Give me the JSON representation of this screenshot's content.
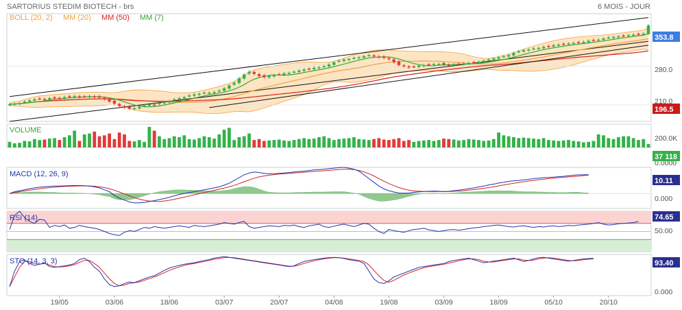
{
  "header": {
    "title": "SARTORIUS STEDIM BIOTECH - brs",
    "period": "6 MOIS - JOUR"
  },
  "colors": {
    "up": "#33b249",
    "down": "#e23a3a",
    "boll": "#f3a13c",
    "bollFill": "#fde5c3",
    "ma20": "#f3a13c",
    "ma50": "#d42020",
    "ma7": "#33aa33",
    "macd": "#2233aa",
    "signal": "#cc2222",
    "rsi": "#2233aa",
    "stoK": "#2233aa",
    "stoD": "#dd2222",
    "tagBlue": "#3d7de0",
    "tagRed": "#c81a1a",
    "tagGreen": "#33b249"
  },
  "chart_data": [
    {
      "type": "candlestick",
      "pane": "price",
      "legend": [
        {
          "label": "BOLL (20, 2)",
          "color": "#f3a13c"
        },
        {
          "label": "MM (20)",
          "color": "#f3a13c"
        },
        {
          "label": "MM (50)",
          "color": "#d42020"
        },
        {
          "label": "MM (7)",
          "color": "#33aa33"
        }
      ],
      "yticks": [
        210,
        280
      ],
      "ytick_labels": [
        "210.0",
        "280.0"
      ],
      "last_price": 353.8,
      "last_price_label": "353.8",
      "marker_value": 196.5,
      "marker_label": "196.5",
      "ylim": [
        180,
        375
      ],
      "trend_channel": {
        "upper": [
          [
            0,
            225
          ],
          [
            128,
            368
          ]
        ],
        "lower": [
          [
            0,
            180
          ],
          [
            128,
            325
          ]
        ]
      },
      "close": [
        211,
        212,
        213,
        216,
        218,
        220,
        221,
        220,
        222,
        223,
        222,
        224,
        225,
        226,
        224,
        225,
        226,
        224,
        223,
        220,
        216,
        212,
        208,
        205,
        203,
        204,
        206,
        209,
        211,
        210,
        213,
        215,
        217,
        220,
        222,
        224,
        227,
        229,
        230,
        232,
        232,
        233,
        236,
        240,
        245,
        250,
        258,
        265,
        270,
        266,
        262,
        260,
        262,
        264,
        265,
        267,
        268,
        270,
        272,
        274,
        275,
        277,
        278,
        280,
        283,
        287,
        290,
        292,
        293,
        295,
        296,
        298,
        300,
        298,
        296,
        295,
        293,
        287,
        282,
        280,
        278,
        279,
        281,
        282,
        283,
        284,
        284,
        283,
        282,
        283,
        284,
        285,
        286,
        287,
        288,
        290,
        292,
        294,
        296,
        298,
        300,
        304,
        307,
        309,
        310,
        312,
        313,
        315,
        316,
        318,
        319,
        320,
        321,
        322,
        323,
        324,
        326,
        327,
        328,
        330,
        332,
        333,
        334,
        335,
        336,
        337,
        338,
        339,
        353.8
      ],
      "volume_k": [
        60,
        45,
        50,
        70,
        65,
        90,
        80,
        85,
        95,
        100,
        80,
        110,
        130,
        180,
        70,
        140,
        150,
        170,
        120,
        130,
        150,
        90,
        160,
        140,
        70,
        65,
        80,
        60,
        220,
        180,
        120,
        90,
        100,
        120,
        110,
        130,
        90,
        85,
        100,
        120,
        110,
        95,
        140,
        190,
        210,
        80,
        110,
        120,
        150,
        80,
        90,
        70,
        75,
        80,
        85,
        75,
        70,
        80,
        90,
        100,
        90,
        95,
        110,
        120,
        100,
        80,
        90,
        95,
        100,
        110,
        90,
        85,
        80,
        90,
        100,
        85,
        80,
        90,
        100,
        70,
        80,
        60,
        70,
        75,
        80,
        70,
        80,
        95,
        90,
        85,
        75,
        80,
        90,
        85,
        80,
        70,
        75,
        90,
        160,
        130,
        120,
        110,
        100,
        105,
        100,
        95,
        90,
        100,
        80,
        75,
        70,
        75,
        80,
        70,
        65,
        55,
        60,
        70,
        140,
        130,
        100,
        90,
        110,
        120,
        120,
        100,
        80,
        90,
        37.118
      ]
    },
    {
      "type": "bar",
      "pane": "volume",
      "title": "VOLUME",
      "yticks": [
        200,
        0
      ],
      "ytick_labels": [
        "200.0K",
        "0.0000"
      ],
      "last_label": "37 118",
      "ylim": [
        0,
        250
      ]
    },
    {
      "type": "line",
      "pane": "macd",
      "title": "MACD (12, 26, 9)",
      "ytick_labels": [
        "0.000"
      ],
      "last_label": "10.11",
      "ylim": [
        -8,
        14
      ],
      "series": [
        {
          "name": "MACD",
          "values": [
            0,
            1,
            1.5,
            2,
            2.6,
            3,
            3.4,
            3.6,
            3.8,
            4,
            4,
            4.1,
            4.2,
            4.3,
            4.3,
            4.2,
            4,
            3.6,
            3,
            2,
            1,
            -1,
            -2.5,
            -3.5,
            -4.5,
            -5,
            -5,
            -4.8,
            -4.3,
            -3.8,
            -3.2,
            -2.7,
            -2,
            -1.2,
            -0.5,
            0,
            0.5,
            1,
            1.5,
            2,
            2.5,
            3,
            3.6,
            4.5,
            5.5,
            7,
            8.5,
            10,
            11,
            11.5,
            11.2,
            10.8,
            10.5,
            10.6,
            10.8,
            11,
            11.2,
            11.5,
            11.8,
            12,
            12.3,
            12.6,
            12.8,
            13,
            13.3,
            13.6,
            13.8,
            14,
            13.6,
            13,
            12,
            10,
            8,
            6,
            4,
            2.5,
            1.5,
            0.8,
            0.3,
            0.2,
            0.3,
            0.6,
            0.9,
            1.1,
            1.2,
            1.3,
            1.2,
            1,
            1.2,
            1.5,
            1.8,
            2.2,
            2.6,
            3,
            3.5,
            4,
            4.6,
            5,
            5.6,
            6,
            6.5,
            6.8,
            7,
            7.3,
            7.6,
            8,
            8.2,
            8.5,
            8.6,
            8.8,
            9,
            9.2,
            9.5,
            9.8,
            10,
            10,
            10.11
          ]
        },
        {
          "name": "Signal",
          "values": [
            0,
            0.5,
            1,
            1.4,
            1.8,
            2.2,
            2.6,
            2.9,
            3.2,
            3.4,
            3.6,
            3.8,
            3.9,
            4,
            4.1,
            4.1,
            4,
            3.9,
            3.6,
            3.2,
            2.6,
            1.8,
            0.8,
            -0.2,
            -1.2,
            -2.2,
            -3,
            -3.6,
            -4,
            -4.2,
            -4.2,
            -4,
            -3.6,
            -3.1,
            -2.5,
            -1.9,
            -1.3,
            -0.7,
            -0.1,
            0.5,
            1.1,
            1.7,
            2.3,
            2.9,
            3.6,
            4.4,
            5.3,
            6.3,
            7.3,
            8.2,
            8.9,
            9.4,
            9.8,
            10.1,
            10.4,
            10.6,
            10.8,
            11,
            11.2,
            11.4,
            11.6,
            11.8,
            12,
            12.2,
            12.4,
            12.6,
            12.8,
            13,
            13,
            12.8,
            12.3,
            11.6,
            10.6,
            9.4,
            8,
            6.6,
            5.3,
            4.2,
            3.2,
            2.4,
            1.8,
            1.4,
            1.2,
            1.1,
            1.1,
            1.1,
            1.1,
            1.1,
            1.1,
            1.2,
            1.3,
            1.5,
            1.8,
            2.1,
            2.4,
            2.8,
            3.2,
            3.6,
            4.1,
            4.6,
            5,
            5.5,
            5.9,
            6.3,
            6.7,
            7,
            7.4,
            7.7,
            8,
            8.2,
            8.5,
            8.7,
            8.9,
            9.1,
            9.3,
            9.6,
            9.8
          ]
        }
      ]
    },
    {
      "type": "line",
      "pane": "rsi",
      "title": "RSI (14)",
      "ytick_labels": [
        "50.00"
      ],
      "last_label": "74.65",
      "ylim": [
        0,
        100
      ],
      "overbought": 70,
      "oversold": 30,
      "series": [
        {
          "name": "RSI",
          "values": [
            55,
            90,
            100,
            85,
            75,
            70,
            80,
            78,
            60,
            65,
            62,
            66,
            58,
            60,
            65,
            62,
            60,
            58,
            55,
            50,
            45,
            42,
            40,
            48,
            52,
            50,
            55,
            60,
            58,
            62,
            60,
            58,
            60,
            62,
            64,
            62,
            60,
            65,
            63,
            62,
            64,
            66,
            68,
            72,
            70,
            68,
            72,
            75,
            62,
            58,
            60,
            62,
            64,
            63,
            62,
            65,
            64,
            66,
            62,
            60,
            64,
            66,
            68,
            62,
            60,
            63,
            66,
            68,
            65,
            62,
            66,
            70,
            68,
            58,
            50,
            45,
            55,
            52,
            50,
            48,
            52,
            55,
            56,
            58,
            54,
            52,
            50,
            52,
            54,
            55,
            53,
            55,
            57,
            59,
            60,
            62,
            63,
            65,
            66,
            64,
            62,
            61,
            63,
            64,
            62,
            60,
            62,
            61,
            63,
            64,
            62,
            63,
            65,
            64,
            66,
            67,
            68,
            70,
            72,
            68,
            66,
            67,
            69,
            70,
            71,
            72,
            74.65
          ]
        }
      ]
    },
    {
      "type": "line",
      "pane": "sto",
      "title": "STO (14, 3, 3)",
      "ytick_labels": [
        "0.000"
      ],
      "last_label": "93.40",
      "ylim": [
        0,
        100
      ],
      "series": [
        {
          "name": "%K",
          "values": [
            20,
            60,
            85,
            90,
            80,
            75,
            78,
            82,
            72,
            70,
            72,
            74,
            76,
            80,
            90,
            94,
            85,
            70,
            60,
            40,
            25,
            20,
            22,
            28,
            32,
            30,
            35,
            40,
            45,
            48,
            55,
            62,
            68,
            72,
            75,
            78,
            80,
            82,
            85,
            88,
            90,
            94,
            96,
            98,
            96,
            94,
            92,
            90,
            88,
            86,
            84,
            82,
            80,
            78,
            76,
            74,
            72,
            74,
            80,
            85,
            88,
            90,
            92,
            94,
            95,
            96,
            95,
            93,
            90,
            88,
            86,
            80,
            60,
            40,
            30,
            28,
            35,
            45,
            50,
            55,
            60,
            65,
            70,
            72,
            74,
            76,
            78,
            80,
            85,
            88,
            90,
            92,
            94,
            90,
            86,
            82,
            84,
            86,
            88,
            90,
            92,
            94,
            90,
            85,
            88,
            92,
            95,
            96,
            94,
            92,
            90,
            88,
            86,
            88,
            90,
            92,
            93,
            93.4
          ]
        },
        {
          "name": "%D",
          "values": [
            20,
            45,
            70,
            85,
            85,
            80,
            78,
            80,
            76,
            72,
            71,
            72,
            74,
            77,
            83,
            88,
            88,
            80,
            70,
            55,
            40,
            28,
            22,
            24,
            28,
            30,
            32,
            36,
            41,
            45,
            50,
            56,
            62,
            67,
            71,
            75,
            78,
            80,
            83,
            85,
            88,
            91,
            93,
            95,
            96,
            95,
            93,
            91,
            89,
            87,
            85,
            83,
            81,
            79,
            77,
            75,
            73,
            73,
            76,
            80,
            84,
            87,
            90,
            92,
            94,
            95,
            95,
            94,
            92,
            90,
            88,
            85,
            76,
            62,
            48,
            36,
            31,
            36,
            43,
            50,
            55,
            60,
            65,
            69,
            72,
            74,
            76,
            78,
            81,
            84,
            87,
            90,
            92,
            92,
            90,
            86,
            84,
            84,
            86,
            88,
            90,
            92,
            92,
            89,
            88,
            89,
            92,
            94,
            95,
            94,
            92,
            90,
            88,
            87,
            88,
            90,
            91,
            92
          ]
        }
      ]
    }
  ],
  "xaxis": {
    "labels": [
      "19/05",
      "03/06",
      "18/06",
      "03/07",
      "20/07",
      "04/08",
      "19/08",
      "03/09",
      "18/09",
      "05/10",
      "20/10"
    ],
    "label_index": [
      10,
      21,
      32,
      43,
      54,
      65,
      76,
      87,
      98,
      109,
      120
    ]
  }
}
